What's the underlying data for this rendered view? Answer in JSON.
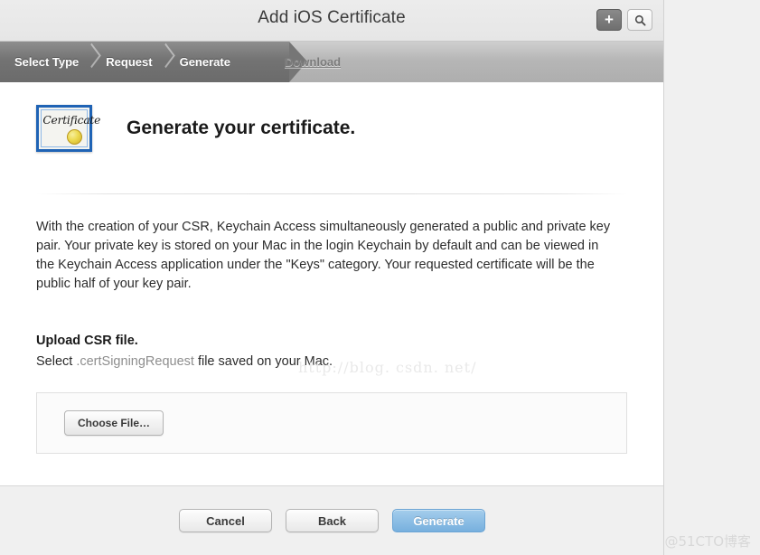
{
  "window": {
    "title": "Add iOS Certificate",
    "add_button_icon": "plus-icon",
    "search_button_icon": "search-icon"
  },
  "steps": [
    {
      "label": "Select Type",
      "state": "done"
    },
    {
      "label": "Request",
      "state": "done"
    },
    {
      "label": "Generate",
      "state": "current"
    },
    {
      "label": "Download",
      "state": "todo"
    }
  ],
  "main": {
    "icon_label": "Certificate",
    "heading": "Generate your certificate.",
    "paragraph": "With the creation of your CSR, Keychain Access simultaneously generated a public and private key pair. Your private key is stored on your Mac in the login Keychain by default and can be viewed in the Keychain Access application under the \"Keys\" category. Your requested certificate will be the public half of your key pair.",
    "upload_heading": "Upload CSR file.",
    "upload_select_prefix": "Select ",
    "upload_extension": ".certSigningRequest",
    "upload_select_suffix": " file saved on your Mac.",
    "choose_file_label": "Choose File…"
  },
  "footer": {
    "cancel_label": "Cancel",
    "back_label": "Back",
    "generate_label": "Generate"
  },
  "watermarks": {
    "csdn": "http://blog. csdn. net/",
    "cto": "@51CTO博客"
  },
  "colors": {
    "accent_blue": "#77b0de",
    "step_active": "#737373",
    "step_bar": "#b6b6b6",
    "cert_border": "#1f63b5"
  }
}
